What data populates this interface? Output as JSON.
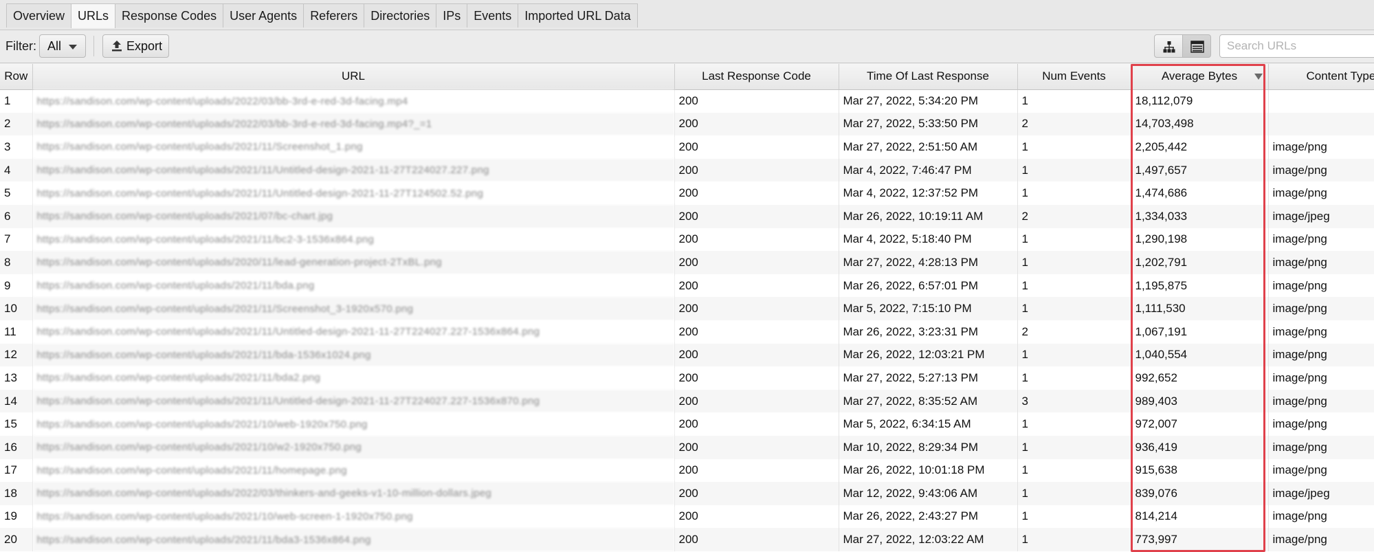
{
  "tabs": [
    {
      "label": "Overview",
      "active": false
    },
    {
      "label": "URLs",
      "active": true
    },
    {
      "label": "Response Codes",
      "active": false
    },
    {
      "label": "User Agents",
      "active": false
    },
    {
      "label": "Referers",
      "active": false
    },
    {
      "label": "Directories",
      "active": false
    },
    {
      "label": "IPs",
      "active": false
    },
    {
      "label": "Events",
      "active": false
    },
    {
      "label": "Imported URL Data",
      "active": false
    }
  ],
  "toolbar": {
    "filter_label": "Filter:",
    "filter_value": "All",
    "export_label": "Export",
    "search_placeholder": "Search URLs",
    "icons": {
      "export": "upload-icon",
      "tree_view": "tree-view-icon",
      "list_view": "list-view-icon",
      "filter_caret": "caret-down-icon",
      "sort": "sort-descending-icon"
    }
  },
  "table": {
    "columns": [
      "Row",
      "URL",
      "Last Response Code",
      "Time Of Last Response",
      "Num Events",
      "Average Bytes",
      "Content Type"
    ],
    "sorted_column": "Average Bytes",
    "highlight_color": "#e0414b",
    "rows": [
      {
        "row": "1",
        "url": "https://sandison.com/wp-content/uploads/2022/03/bb-3rd-e-red-3d-facing.mp4",
        "code": "200",
        "time": "Mar 27, 2022, 5:34:20 PM",
        "events": "1",
        "bytes": "18,112,079",
        "type": ""
      },
      {
        "row": "2",
        "url": "https://sandison.com/wp-content/uploads/2022/03/bb-3rd-e-red-3d-facing.mp4?_=1",
        "code": "200",
        "time": "Mar 27, 2022, 5:33:50 PM",
        "events": "2",
        "bytes": "14,703,498",
        "type": ""
      },
      {
        "row": "3",
        "url": "https://sandison.com/wp-content/uploads/2021/11/Screenshot_1.png",
        "code": "200",
        "time": "Mar 27, 2022, 2:51:50 AM",
        "events": "1",
        "bytes": "2,205,442",
        "type": "image/png"
      },
      {
        "row": "4",
        "url": "https://sandison.com/wp-content/uploads/2021/11/Untitled-design-2021-11-27T224027.227.png",
        "code": "200",
        "time": "Mar 4, 2022, 7:46:47 PM",
        "events": "1",
        "bytes": "1,497,657",
        "type": "image/png"
      },
      {
        "row": "5",
        "url": "https://sandison.com/wp-content/uploads/2021/11/Untitled-design-2021-11-27T124502.52.png",
        "code": "200",
        "time": "Mar 4, 2022, 12:37:52 PM",
        "events": "1",
        "bytes": "1,474,686",
        "type": "image/png"
      },
      {
        "row": "6",
        "url": "https://sandison.com/wp-content/uploads/2021/07/bc-chart.jpg",
        "code": "200",
        "time": "Mar 26, 2022, 10:19:11 AM",
        "events": "2",
        "bytes": "1,334,033",
        "type": "image/jpeg"
      },
      {
        "row": "7",
        "url": "https://sandison.com/wp-content/uploads/2021/11/bc2-3-1536x864.png",
        "code": "200",
        "time": "Mar 4, 2022, 5:18:40 PM",
        "events": "1",
        "bytes": "1,290,198",
        "type": "image/png"
      },
      {
        "row": "8",
        "url": "https://sandison.com/wp-content/uploads/2020/11/lead-generation-project-2TxBL.png",
        "code": "200",
        "time": "Mar 27, 2022, 4:28:13 PM",
        "events": "1",
        "bytes": "1,202,791",
        "type": "image/png"
      },
      {
        "row": "9",
        "url": "https://sandison.com/wp-content/uploads/2021/11/bda.png",
        "code": "200",
        "time": "Mar 26, 2022, 6:57:01 PM",
        "events": "1",
        "bytes": "1,195,875",
        "type": "image/png"
      },
      {
        "row": "10",
        "url": "https://sandison.com/wp-content/uploads/2021/11/Screenshot_3-1920x570.png",
        "code": "200",
        "time": "Mar 5, 2022, 7:15:10 PM",
        "events": "1",
        "bytes": "1,111,530",
        "type": "image/png"
      },
      {
        "row": "11",
        "url": "https://sandison.com/wp-content/uploads/2021/11/Untitled-design-2021-11-27T224027.227-1536x864.png",
        "code": "200",
        "time": "Mar 26, 2022, 3:23:31 PM",
        "events": "2",
        "bytes": "1,067,191",
        "type": "image/png"
      },
      {
        "row": "12",
        "url": "https://sandison.com/wp-content/uploads/2021/11/bda-1536x1024.png",
        "code": "200",
        "time": "Mar 26, 2022, 12:03:21 PM",
        "events": "1",
        "bytes": "1,040,554",
        "type": "image/png"
      },
      {
        "row": "13",
        "url": "https://sandison.com/wp-content/uploads/2021/11/bda2.png",
        "code": "200",
        "time": "Mar 27, 2022, 5:27:13 PM",
        "events": "1",
        "bytes": "992,652",
        "type": "image/png"
      },
      {
        "row": "14",
        "url": "https://sandison.com/wp-content/uploads/2021/11/Untitled-design-2021-11-27T224027.227-1536x870.png",
        "code": "200",
        "time": "Mar 27, 2022, 8:35:52 AM",
        "events": "3",
        "bytes": "989,403",
        "type": "image/png"
      },
      {
        "row": "15",
        "url": "https://sandison.com/wp-content/uploads/2021/10/web-1920x750.png",
        "code": "200",
        "time": "Mar 5, 2022, 6:34:15 AM",
        "events": "1",
        "bytes": "972,007",
        "type": "image/png"
      },
      {
        "row": "16",
        "url": "https://sandison.com/wp-content/uploads/2021/10/w2-1920x750.png",
        "code": "200",
        "time": "Mar 10, 2022, 8:29:34 PM",
        "events": "1",
        "bytes": "936,419",
        "type": "image/png"
      },
      {
        "row": "17",
        "url": "https://sandison.com/wp-content/uploads/2021/11/homepage.png",
        "code": "200",
        "time": "Mar 26, 2022, 10:01:18 PM",
        "events": "1",
        "bytes": "915,638",
        "type": "image/png"
      },
      {
        "row": "18",
        "url": "https://sandison.com/wp-content/uploads/2022/03/thinkers-and-geeks-v1-10-million-dollars.jpeg",
        "code": "200",
        "time": "Mar 12, 2022, 9:43:06 AM",
        "events": "1",
        "bytes": "839,076",
        "type": "image/jpeg"
      },
      {
        "row": "19",
        "url": "https://sandison.com/wp-content/uploads/2021/10/web-screen-1-1920x750.png",
        "code": "200",
        "time": "Mar 26, 2022, 2:43:27 PM",
        "events": "1",
        "bytes": "814,214",
        "type": "image/png"
      },
      {
        "row": "20",
        "url": "https://sandison.com/wp-content/uploads/2021/11/bda3-1536x864.png",
        "code": "200",
        "time": "Mar 27, 2022, 12:03:22 AM",
        "events": "1",
        "bytes": "773,997",
        "type": "image/png"
      }
    ]
  }
}
